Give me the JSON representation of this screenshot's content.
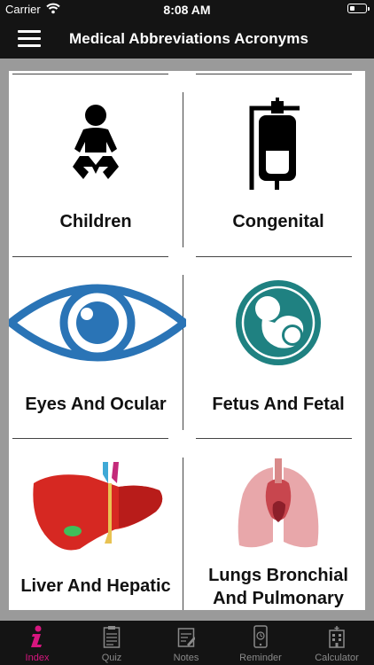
{
  "status": {
    "carrier": "Carrier",
    "time": "8:08 AM"
  },
  "header": {
    "title": "Medical Abbreviations Acronyms",
    "menu_icon": "hamburger-menu-icon"
  },
  "categories": [
    {
      "label": "Children",
      "icon": "baby-icon"
    },
    {
      "label": "Congenital",
      "icon": "iv-bag-icon"
    },
    {
      "label": "Eyes And Ocular",
      "icon": "eye-icon"
    },
    {
      "label": "Fetus And Fetal",
      "icon": "fetus-icon"
    },
    {
      "label": "Liver And Hepatic",
      "icon": "liver-icon"
    },
    {
      "label_line1": "Lungs Bronchial",
      "label_line2": "And Pulmonary",
      "icon": "lungs-icon"
    }
  ],
  "tabs": [
    {
      "label": "Index",
      "icon": "info-icon",
      "active": true
    },
    {
      "label": "Quiz",
      "icon": "clipboard-icon"
    },
    {
      "label": "Notes",
      "icon": "notes-icon"
    },
    {
      "label": "Reminder",
      "icon": "phone-icon"
    },
    {
      "label": "Calculator",
      "icon": "hospital-icon"
    }
  ],
  "colors": {
    "accent": "#d7167f",
    "eye": "#2a74b6",
    "fetus": "#1f8181",
    "bar": "#141414"
  }
}
